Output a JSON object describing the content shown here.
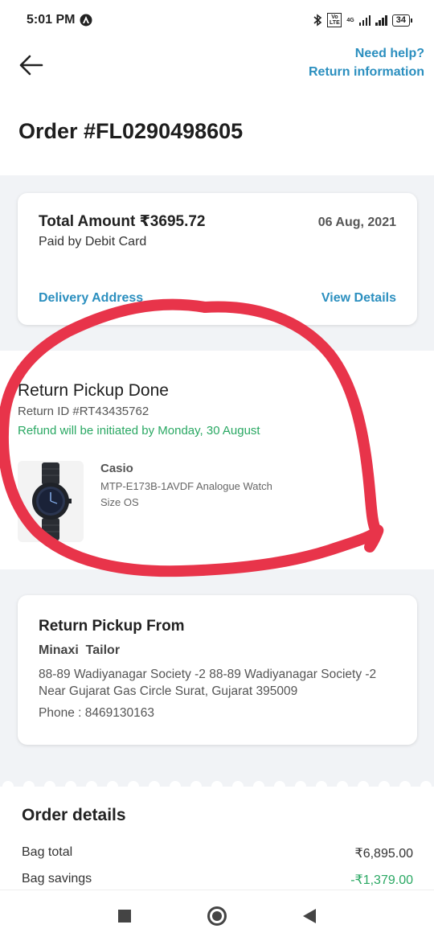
{
  "status_bar": {
    "time": "5:01 PM",
    "network_label": "4G",
    "volte_label": "Vo LTE",
    "battery": "34"
  },
  "header": {
    "need_help": "Need help?",
    "return_information": "Return information"
  },
  "order": {
    "title": "Order #FL0290498605"
  },
  "summary": {
    "total_amount": "Total Amount ₹3695.72",
    "paid_by": "Paid by Debit Card",
    "date": "06 Aug, 2021",
    "delivery_address": "Delivery Address",
    "view_details": "View Details"
  },
  "return": {
    "status": "Return Pickup Done",
    "return_id": "Return ID #RT43435762",
    "refund_note": "Refund will be initiated by Monday, 30 August",
    "product": {
      "brand": "Casio",
      "name": "MTP-E173B-1AVDF Analogue Watch",
      "size": "Size OS"
    }
  },
  "pickup": {
    "title": "Return Pickup From",
    "name": "Minaxi  Tailor",
    "address": "88-89 Wadiyanagar Society -2 88-89 Wadiyanagar Society -2 Near Gujarat Gas Circle Surat, Gujarat 395009",
    "phone": "Phone : 8469130163"
  },
  "order_details": {
    "title": "Order details",
    "rows": [
      {
        "label": "Bag total",
        "value": "₹6,895.00"
      },
      {
        "label": "Bag savings",
        "value": "-₹1,379.00"
      }
    ]
  },
  "colors": {
    "link": "#2b8fbf",
    "success": "#2aa863",
    "annotation": "#e8344a",
    "band": "#f1f3f6"
  }
}
